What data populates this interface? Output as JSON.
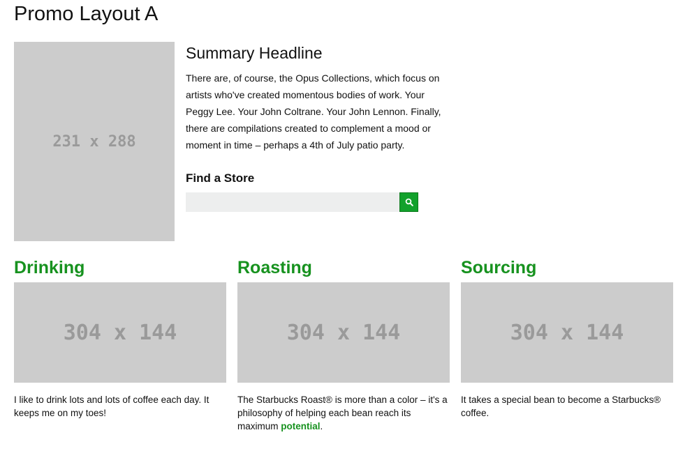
{
  "page": {
    "title": "Promo Layout A"
  },
  "hero": {
    "image_label": "231 x 288"
  },
  "summary": {
    "headline": "Summary Headline",
    "body": "There are, of course, the Opus Collections, which focus on artists who've created momentous bodies of work. Your Peggy Lee. Your John Coltrane. Your John Lennon. Finally, there are compilations created to complement a mood or moment in time – perhaps a 4th of July patio party."
  },
  "find_store": {
    "heading": "Find a Store",
    "input_value": "",
    "button_icon": "search-icon"
  },
  "columns": [
    {
      "heading": "Drinking",
      "image_label": "304 x 144",
      "text": "I like to drink lots and lots of coffee each day. It keeps me on my toes!"
    },
    {
      "heading": "Roasting",
      "image_label": "304 x 144",
      "text_before": "The Starbucks Roast® is more than a color – it's a philosophy of helping each bean reach its maximum ",
      "link_text": "potential",
      "text_after": "."
    },
    {
      "heading": "Sourcing",
      "image_label": "304 x 144",
      "text": "It takes a special bean to become a Starbucks® coffee."
    }
  ],
  "colors": {
    "accent_green": "#17921f",
    "button_green": "#12a12c",
    "placeholder_gray": "#cccccc",
    "placeholder_text": "#9a9a9a",
    "input_bg": "#edeeee"
  }
}
